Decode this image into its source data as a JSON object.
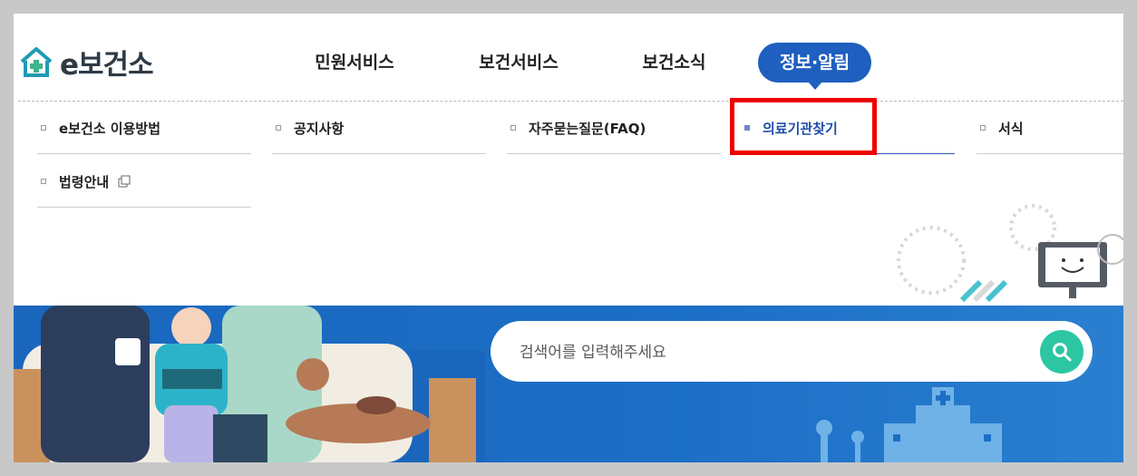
{
  "logo": {
    "text": "e보건소",
    "icon": "home-plus-icon"
  },
  "gnb": {
    "items": [
      {
        "label": "민원서비스",
        "active": false
      },
      {
        "label": "보건서비스",
        "active": false
      },
      {
        "label": "보건소식",
        "active": false
      },
      {
        "label": "정보·알림",
        "active": true
      }
    ]
  },
  "submenu": {
    "items": [
      {
        "label": "e보건소 이용방법",
        "active": false
      },
      {
        "label": "공지사항",
        "active": false
      },
      {
        "label": "자주묻는질문(FAQ)",
        "active": false
      },
      {
        "label": "의료기관찾기",
        "active": true
      },
      {
        "label": "서식",
        "active": false
      },
      {
        "label": "법령안내",
        "active": false,
        "external": true
      }
    ]
  },
  "search": {
    "placeholder": "검색어를 입력해주세요",
    "button_icon": "search-icon"
  },
  "colors": {
    "accent": "#1f5fbf",
    "banner": "#1c6fc6",
    "search_button": "#2cc7a2",
    "highlight_box": "#ee0000"
  }
}
